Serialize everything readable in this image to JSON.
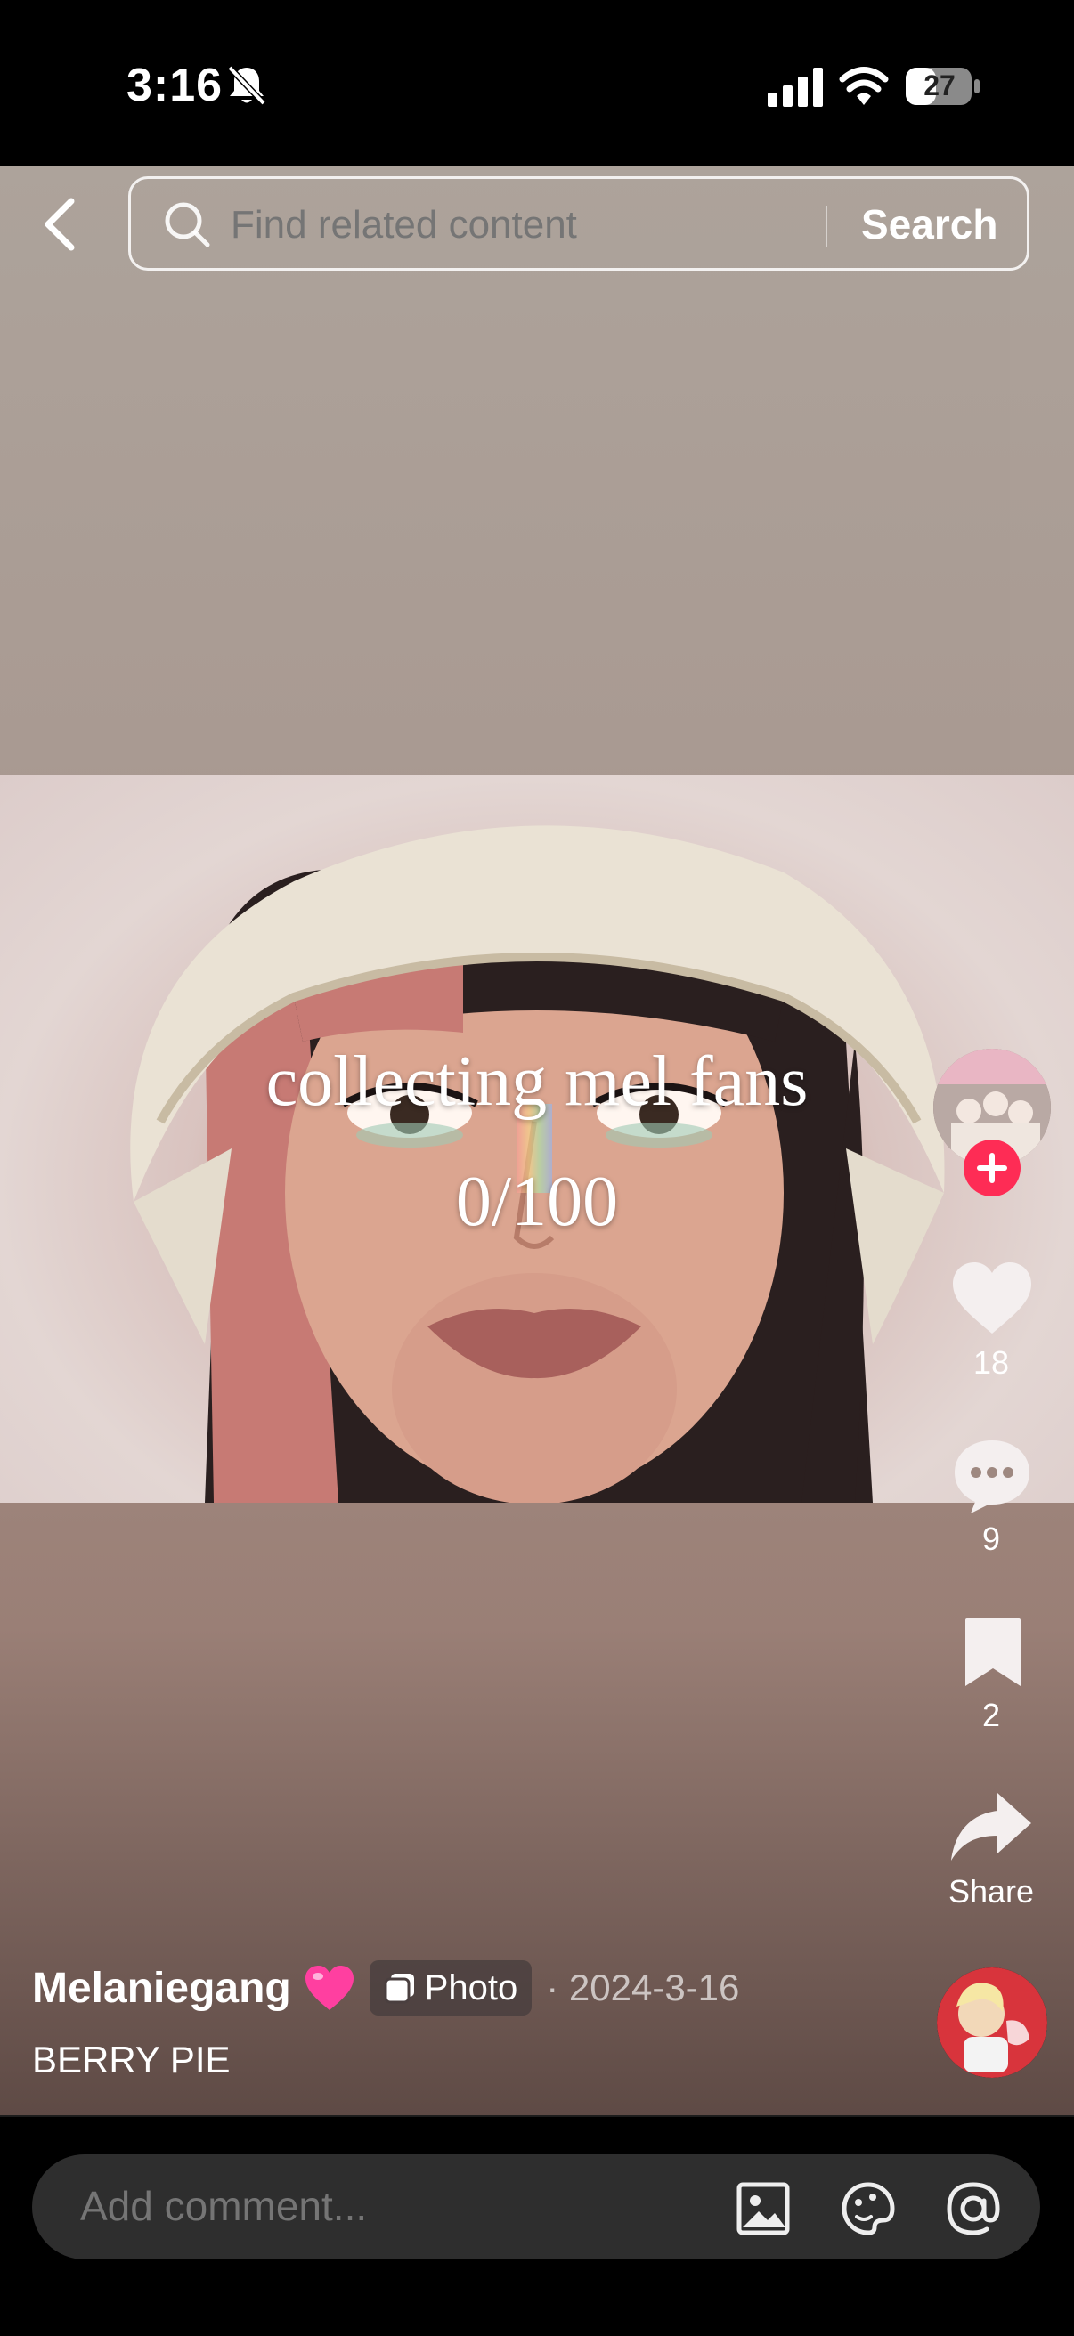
{
  "status_bar": {
    "time": "3:16",
    "battery": "27"
  },
  "search": {
    "placeholder": "Find related content",
    "button_label": "Search"
  },
  "post": {
    "overlay_text": [
      "collecting mel fans",
      "0/100"
    ],
    "likes": "18",
    "comments": "9",
    "bookmarks": "2",
    "share_label": "Share",
    "author": "Melaniegang",
    "author_emoji": "💗",
    "badge_label": "Photo",
    "date": "· 2024-3-16",
    "description": "BERRY PIE"
  },
  "comment_bar": {
    "placeholder": "Add comment..."
  },
  "colors": {
    "accent": "#fe2c55"
  }
}
